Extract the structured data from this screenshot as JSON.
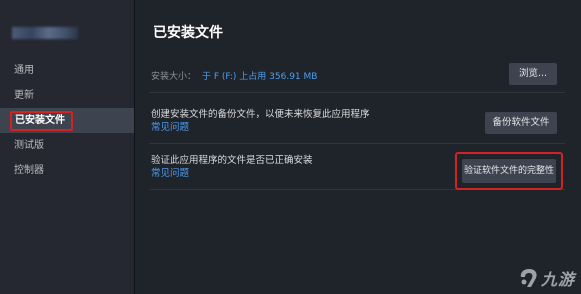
{
  "sidebar": {
    "items": [
      {
        "label": "通用"
      },
      {
        "label": "更新"
      },
      {
        "label": "已安装文件",
        "active": true
      },
      {
        "label": "测试版"
      },
      {
        "label": "控制器"
      }
    ]
  },
  "main": {
    "title": "已安装文件",
    "install_size": {
      "label": "安装大小：",
      "value": "于 F (F:) 上占用 356.91 MB",
      "browse_label": "浏览..."
    },
    "backup": {
      "text": "创建安装文件的备份文件，以便未来恢复此应用程序",
      "link": "常见问题",
      "button_label": "备份软件文件"
    },
    "verify": {
      "text": "验证此应用程序的文件是否已正确安装",
      "link": "常见问题",
      "button_label": "验证软件文件的完整性"
    }
  },
  "watermark": {
    "text": "九游"
  },
  "colors": {
    "accent": "#4d9ef0",
    "highlight": "#d42222",
    "background": "#1f232a",
    "sidebar": "#252830"
  }
}
